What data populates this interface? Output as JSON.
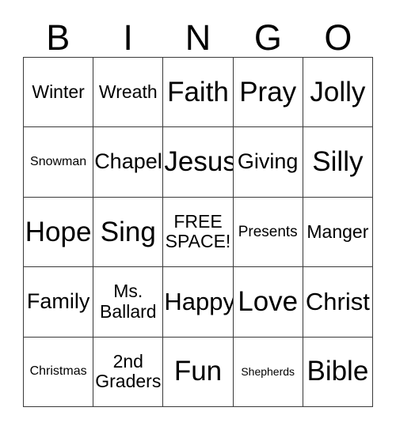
{
  "card": {
    "header_letters": [
      "B",
      "I",
      "N",
      "G",
      "O"
    ],
    "columns": 5,
    "rows": 5,
    "background_color": "#ffffff",
    "border_color": "#3a3a3a",
    "text_color": "#000000",
    "cells": [
      {
        "text": "Winter",
        "size": "md",
        "lines": 1
      },
      {
        "text": "Wreath",
        "size": "md",
        "lines": 1
      },
      {
        "text": "Faith",
        "size": "xxl",
        "lines": 1
      },
      {
        "text": "Pray",
        "size": "xxl",
        "lines": 1
      },
      {
        "text": "Jolly",
        "size": "xxl",
        "lines": 1
      },
      {
        "text": "Snowman",
        "size": "xs",
        "lines": 1
      },
      {
        "text": "Chapel",
        "size": "lg",
        "lines": 1
      },
      {
        "text": "Jesus",
        "size": "xxl",
        "lines": 1
      },
      {
        "text": "Giving",
        "size": "lg",
        "lines": 1
      },
      {
        "text": "Silly",
        "size": "xxl",
        "lines": 1
      },
      {
        "text": "Hope",
        "size": "xxl",
        "lines": 1
      },
      {
        "text": "Sing",
        "size": "xxl",
        "lines": 1
      },
      {
        "text": "FREE\nSPACE!",
        "size": "md",
        "lines": 2
      },
      {
        "text": "Presents",
        "size": "sm",
        "lines": 1
      },
      {
        "text": "Manger",
        "size": "md",
        "lines": 1
      },
      {
        "text": "Family",
        "size": "lg",
        "lines": 1
      },
      {
        "text": "Ms.\nBallard",
        "size": "md",
        "lines": 2
      },
      {
        "text": "Happy",
        "size": "xl",
        "lines": 1
      },
      {
        "text": "Love",
        "size": "xxl",
        "lines": 1
      },
      {
        "text": "Christ",
        "size": "xl",
        "lines": 1
      },
      {
        "text": "Christmas",
        "size": "xs",
        "lines": 1
      },
      {
        "text": "2nd\nGraders",
        "size": "md",
        "lines": 2
      },
      {
        "text": "Fun",
        "size": "xxl",
        "lines": 1
      },
      {
        "text": "Shepherds",
        "size": "xxs",
        "lines": 1
      },
      {
        "text": "Bible",
        "size": "xxl",
        "lines": 1
      }
    ]
  }
}
